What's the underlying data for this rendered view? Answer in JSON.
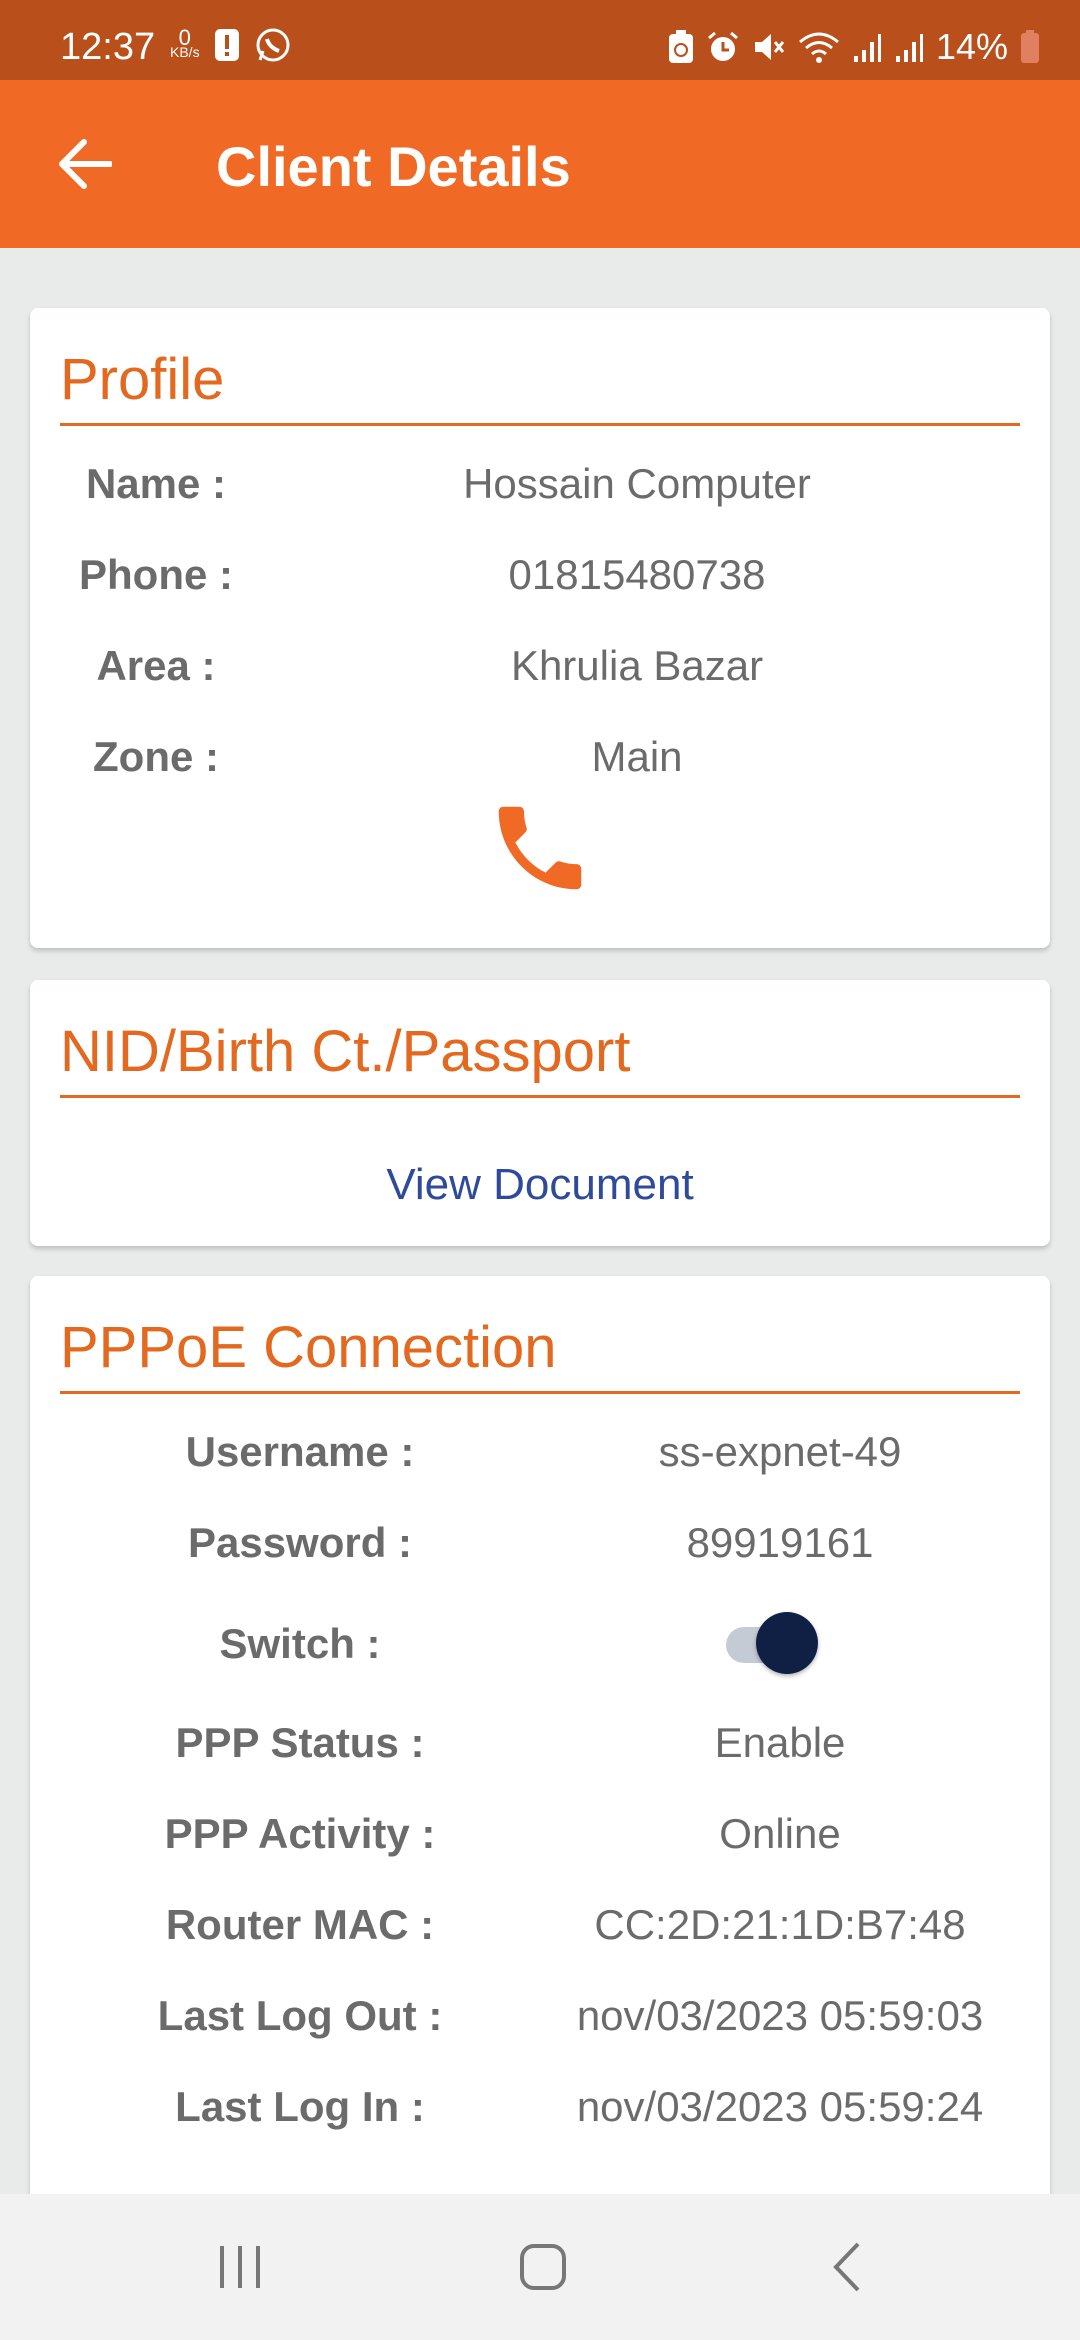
{
  "status_bar": {
    "time": "12:37",
    "speed_value": "0",
    "speed_unit": "KB/s",
    "battery": "14%",
    "icons": [
      "alert-icon",
      "whatsapp-icon",
      "recycle-icon",
      "alarm-icon",
      "mute-icon",
      "wifi-icon",
      "signal-icon",
      "signal-icon",
      "battery-icon"
    ]
  },
  "app_bar": {
    "title": "Client Details"
  },
  "profile": {
    "title": "Profile",
    "rows": [
      {
        "label": "Name :",
        "value": "Hossain Computer"
      },
      {
        "label": "Phone :",
        "value": "01815480738"
      },
      {
        "label": "Area :",
        "value": "Khrulia Bazar"
      },
      {
        "label": "Zone :",
        "value": "Main"
      }
    ]
  },
  "nid": {
    "title": "NID/Birth Ct./Passport",
    "link": "View Document"
  },
  "pppoe": {
    "title": "PPPoE Connection",
    "username_label": "Username :",
    "username": "ss-expnet-49",
    "password_label": "Password :",
    "password": "89919161",
    "switch_label": "Switch :",
    "switch_on": true,
    "status_label": "PPP Status :",
    "status": "Enable",
    "activity_label": "PPP Activity :",
    "activity": "Online",
    "mac_label": "Router MAC :",
    "mac": "CC:2D:21:1D:B7:48",
    "logout_label": "Last Log Out :",
    "logout": "nov/03/2023 05:59:03",
    "login_label": "Last Log In :",
    "login": "nov/03/2023 05:59:24"
  },
  "colors": {
    "accent": "#f06a25",
    "status_bar": "#b94f1b",
    "link": "#2f4a9a",
    "toggle_knob": "#0f2044"
  }
}
